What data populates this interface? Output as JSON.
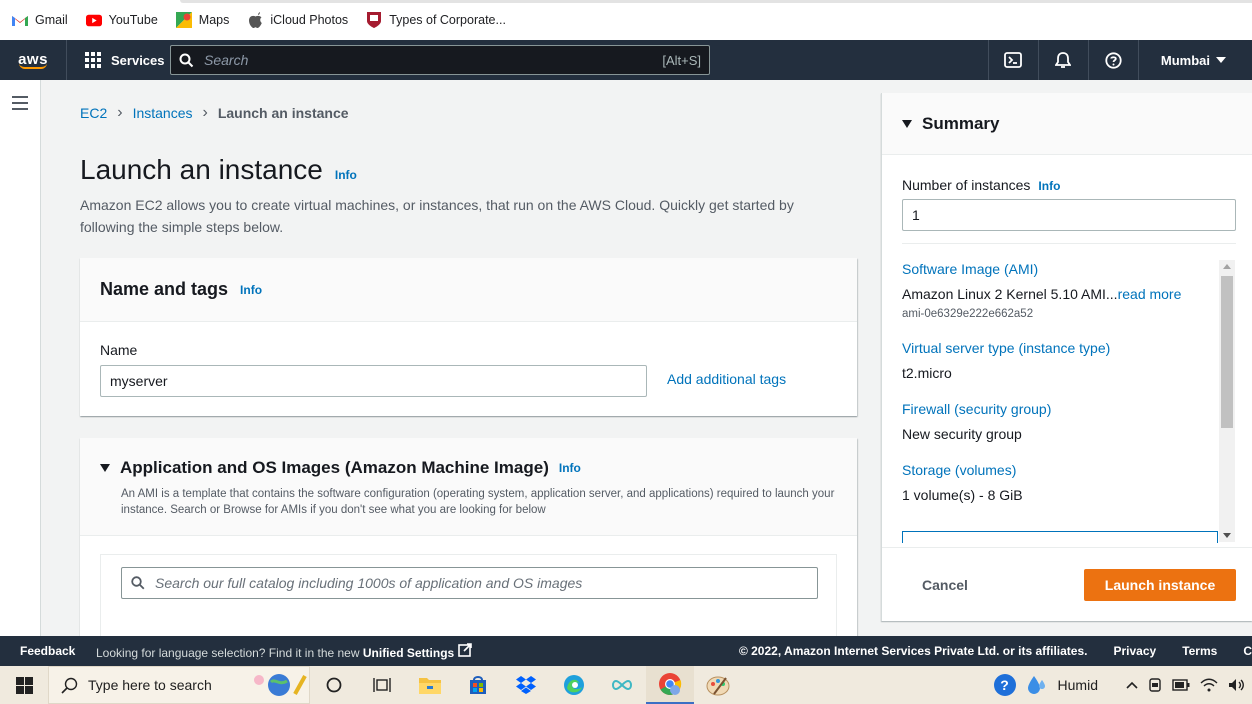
{
  "bookmarks": [
    {
      "label": "Gmail",
      "icon": "gmail-icon"
    },
    {
      "label": "YouTube",
      "icon": "youtube-icon"
    },
    {
      "label": "Maps",
      "icon": "maps-icon"
    },
    {
      "label": "iCloud Photos",
      "icon": "apple-icon"
    },
    {
      "label": "Types of Corporate...",
      "icon": "harvard-icon"
    }
  ],
  "nav": {
    "logo": "aws",
    "services": "Services",
    "search_placeholder": "Search",
    "search_shortcut": "[Alt+S]",
    "region": "Mumbai"
  },
  "breadcrumb": {
    "items": [
      "EC2",
      "Instances"
    ],
    "current": "Launch an instance"
  },
  "page": {
    "title": "Launch an instance",
    "info": "Info",
    "description": "Amazon EC2 allows you to create virtual machines, or instances, that run on the AWS Cloud. Quickly get started by following the simple steps below."
  },
  "name_tags": {
    "title": "Name and tags",
    "info": "Info",
    "name_label": "Name",
    "name_value": "myserver",
    "add_tags": "Add additional tags"
  },
  "ami": {
    "title": "Application and OS Images (Amazon Machine Image)",
    "info": "Info",
    "description": "An AMI is a template that contains the software configuration (operating system, application server, and applications) required to launch your instance. Search or Browse for AMIs if you don't see what you are looking for below",
    "search_placeholder": "Search our full catalog including 1000s of application and OS images"
  },
  "summary": {
    "title": "Summary",
    "num_label": "Number of instances",
    "info": "Info",
    "num_value": "1",
    "items": [
      {
        "key": "Software Image (AMI)",
        "value": "Amazon Linux 2 Kernel 5.10 AMI...",
        "link": "read more",
        "id": "ami-0e6329e222e662a52"
      },
      {
        "key": "Virtual server type (instance type)",
        "value": "t2.micro"
      },
      {
        "key": "Firewall (security group)",
        "value": "New security group"
      },
      {
        "key": "Storage (volumes)",
        "value": "1 volume(s) - 8 GiB"
      }
    ],
    "cancel": "Cancel",
    "launch": "Launch instance"
  },
  "footer": {
    "feedback": "Feedback",
    "lang_text": "Looking for language selection? Find it in the new",
    "lang_link": "Unified Settings",
    "copyright": "© 2022, Amazon Internet Services Private Ltd. or its affiliates.",
    "privacy": "Privacy",
    "terms": "Terms",
    "cookie": "C"
  },
  "taskbar": {
    "search_placeholder": "Type here to search",
    "weather": "Humid"
  },
  "colors": {
    "nav_bg": "#232f3e",
    "link": "#0073bb",
    "primary_button": "#ec7211"
  }
}
